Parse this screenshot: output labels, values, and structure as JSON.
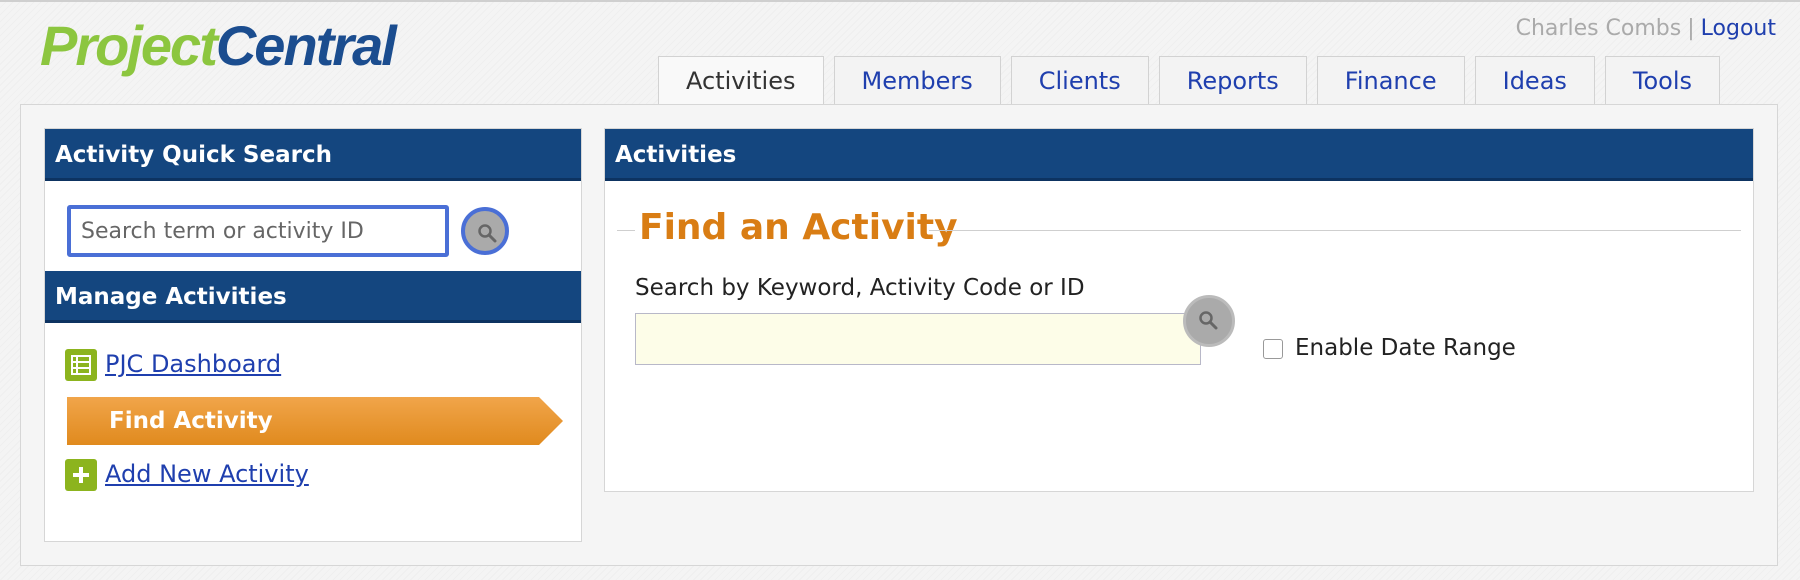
{
  "brand": {
    "logo_part1": "Project",
    "logo_part2": "Central"
  },
  "user": {
    "name": "Charles Combs",
    "separator": "|",
    "logout_label": "Logout"
  },
  "tabs": [
    {
      "label": "Activities",
      "active": true
    },
    {
      "label": "Members"
    },
    {
      "label": "Clients"
    },
    {
      "label": "Reports"
    },
    {
      "label": "Finance"
    },
    {
      "label": "Ideas"
    },
    {
      "label": "Tools"
    }
  ],
  "sidebar": {
    "quick_search": {
      "heading": "Activity Quick Search",
      "placeholder": "Search term or activity ID",
      "value": ""
    },
    "manage": {
      "heading": "Manage Activities",
      "items": [
        {
          "label": "PJC Dashboard",
          "icon": "table-icon"
        },
        {
          "label": "Find Activity",
          "active": true
        },
        {
          "label": "Add New Activity",
          "icon": "plus-icon"
        }
      ]
    }
  },
  "main": {
    "heading": "Activities",
    "section_title": "Find an Activity",
    "search_label": "Search by Keyword, Activity Code or ID",
    "search_value": "",
    "date_range_label": "Enable Date Range",
    "date_range_checked": false
  },
  "colors": {
    "brand_green": "#8cc63f",
    "brand_blue": "#1b4d8f",
    "header_blue": "#14467f",
    "accent_orange": "#d97d14",
    "link_blue": "#1f3fae"
  }
}
